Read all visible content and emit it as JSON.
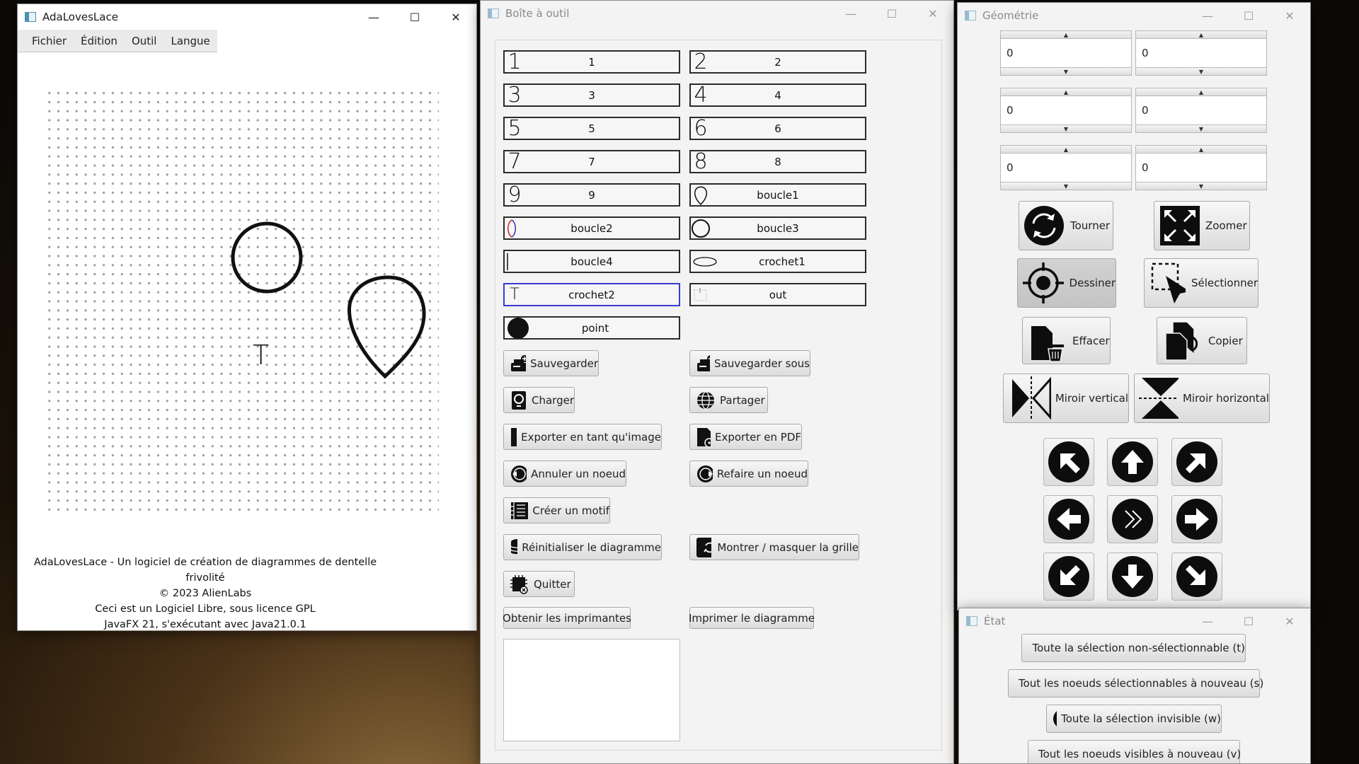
{
  "main": {
    "title": "AdaLovesLace",
    "menu": [
      "Fichier",
      "Édition",
      "Outil",
      "Langue"
    ],
    "canvas_glyph": "T",
    "credits": [
      "AdaLovesLace - Un logiciel de création de diagrammes de dentelle frivolité",
      "© 2023 AlienLabs",
      "Ceci est un Logiciel Libre, sous licence GPL",
      "JavaFX 21, s'exécutant avec Java21.0.1"
    ]
  },
  "toolbox": {
    "title": "Boîte à outil",
    "palette": [
      {
        "icon": "1",
        "label": "1"
      },
      {
        "icon": "2",
        "label": "2"
      },
      {
        "icon": "3",
        "label": "3"
      },
      {
        "icon": "4",
        "label": "4"
      },
      {
        "icon": "5",
        "label": "5"
      },
      {
        "icon": "6",
        "label": "6"
      },
      {
        "icon": "7",
        "label": "7"
      },
      {
        "icon": "8",
        "label": "8"
      },
      {
        "icon": "9",
        "label": "9"
      },
      {
        "icon": "",
        "label": "boucle1"
      },
      {
        "icon": "",
        "label": "boucle2"
      },
      {
        "icon": "",
        "label": "boucle3"
      },
      {
        "icon": "",
        "label": "boucle4"
      },
      {
        "icon": "",
        "label": "crochet1"
      },
      {
        "icon": "T",
        "label": "crochet2"
      },
      {
        "icon": "",
        "label": "out"
      },
      {
        "icon": "",
        "label": "point"
      }
    ],
    "actions": {
      "save": "Sauvegarder",
      "save_as": "Sauvegarder sous",
      "load": "Charger",
      "share": "Partager",
      "export_image": "Exporter en tant qu'image",
      "export_pdf": "Exporter en PDF",
      "undo": "Annuler un noeud",
      "redo": "Refaire un noeud",
      "create_pattern": "Créer un motif",
      "reset": "Réinitialiser le diagramme",
      "toggle_grid": "Montrer / masquer la grille",
      "quit": "Quitter",
      "get_printers": "Obtenir les imprimantes",
      "print": "Imprimer le diagramme"
    }
  },
  "geometry": {
    "title": "Géométrie",
    "spinners": [
      "0",
      "0",
      "0",
      "0",
      "0",
      "0"
    ],
    "tools": {
      "rotate": "Tourner",
      "zoom": "Zoomer",
      "draw": "Dessiner",
      "select": "Sélectionner",
      "erase": "Effacer",
      "copy": "Copier",
      "mirror_v": "Miroir vertical",
      "mirror_h": "Miroir horizontal"
    },
    "arrows": [
      "up-left-arrow-icon",
      "up-arrow-icon",
      "up-right-arrow-icon",
      "left-arrow-icon",
      "center-icon",
      "right-arrow-icon",
      "down-left-arrow-icon",
      "down-arrow-icon",
      "down-right-arrow-icon"
    ]
  },
  "state": {
    "title": "État",
    "buttons": {
      "unselectable": "Toute la sélection non-sélectionnable (t)",
      "selectable_again": "Tout les noeuds sélectionnables à nouveau (s)",
      "invisible": "Toute la sélection invisible (w)",
      "visible_again": "Tout les noeuds visibles à nouveau (v)"
    }
  }
}
